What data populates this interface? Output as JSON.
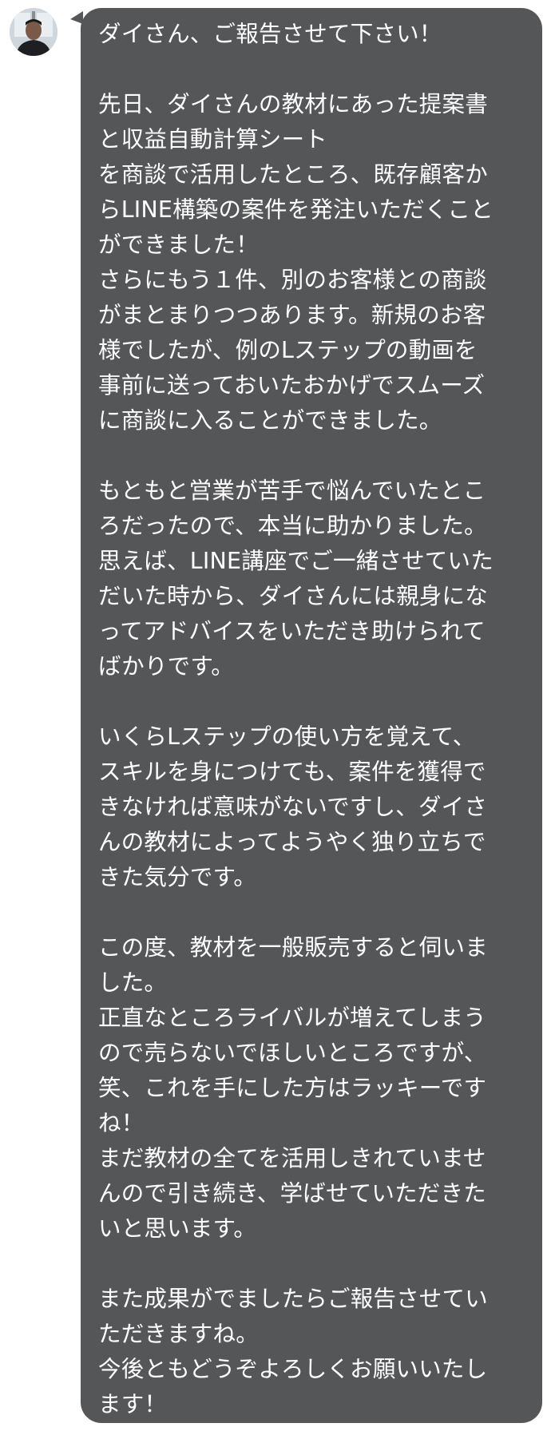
{
  "chat": {
    "message": {
      "lines": [
        "ダイさん、ご報告させて下さい！",
        "",
        "先日、ダイさんの教材にあった提案書",
        "と収益自動計算シート",
        "を商談で活用したところ、既存顧客か",
        "らLINE構築の案件を発注いただくこと",
        "ができました！",
        "さらにもう１件、別のお客様との商談",
        "がまとまりつつあります。新規のお客",
        "様でしたが、例のLステップの動画を",
        "事前に送っておいたおかげでスムーズ",
        "に商談に入ることができました。",
        "",
        "もともと営業が苦手で悩んでいたとこ",
        "ろだったので、本当に助かりました。",
        "思えば、LINE講座でご一緒させていた",
        "だいた時から、ダイさんには親身にな",
        "ってアドバイスをいただき助けられて",
        "ばかりです。",
        "",
        "いくらLステップの使い方を覚えて、",
        "スキルを身につけても、案件を獲得で",
        "きなければ意味がないですし、ダイさ",
        "んの教材によってようやく独り立ちで",
        "きた気分です。",
        "",
        "この度、教材を一般販売すると伺いま",
        "した。",
        "正直なところライバルが増えてしまう",
        "ので売らないでほしいところですが、",
        "笑、これを手にした方はラッキーです",
        "ね！",
        "まだ教材の全てを活用しきれていませ",
        "んので引き続き、学ばせていただきた",
        "いと思います。",
        "",
        "また成果がでましたらご報告させてい",
        "ただきますね。",
        "今後ともどうぞよろしくお願いいたし",
        "ます！"
      ]
    }
  },
  "colors": {
    "bubble_bg": "#545658",
    "text": "#ffffff",
    "page_bg": "#ffffff"
  },
  "icons": {
    "avatar": "user-avatar-photo"
  }
}
